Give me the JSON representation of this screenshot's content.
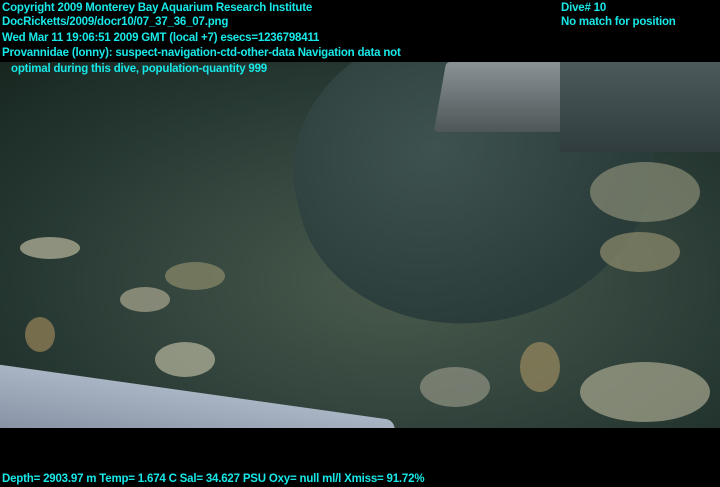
{
  "overlay": {
    "copyright": "Copyright 2009 Monterey Bay Aquarium Research Institute",
    "file": "DocRicketts/2009/docr10/07_37_36_07.png",
    "timestamp": "Wed Mar 11 19:06:51 2009 GMT (local +7)  esecs=1236798411",
    "annotation_line1": "Provannidae (lonny): suspect-navigation-ctd-other-data Navigation data not",
    "annotation_line2": "optimal during this dive, population-quantity 999",
    "dive": "Dive# 10",
    "position": "No match for position",
    "sensors": "Depth= 2903.97 m  Temp= 1.674 C  Sal= 34.627 PSU  Oxy= null ml/l  Xmiss= 91.72%"
  },
  "colors": {
    "overlay_text": "#18e8e8"
  }
}
